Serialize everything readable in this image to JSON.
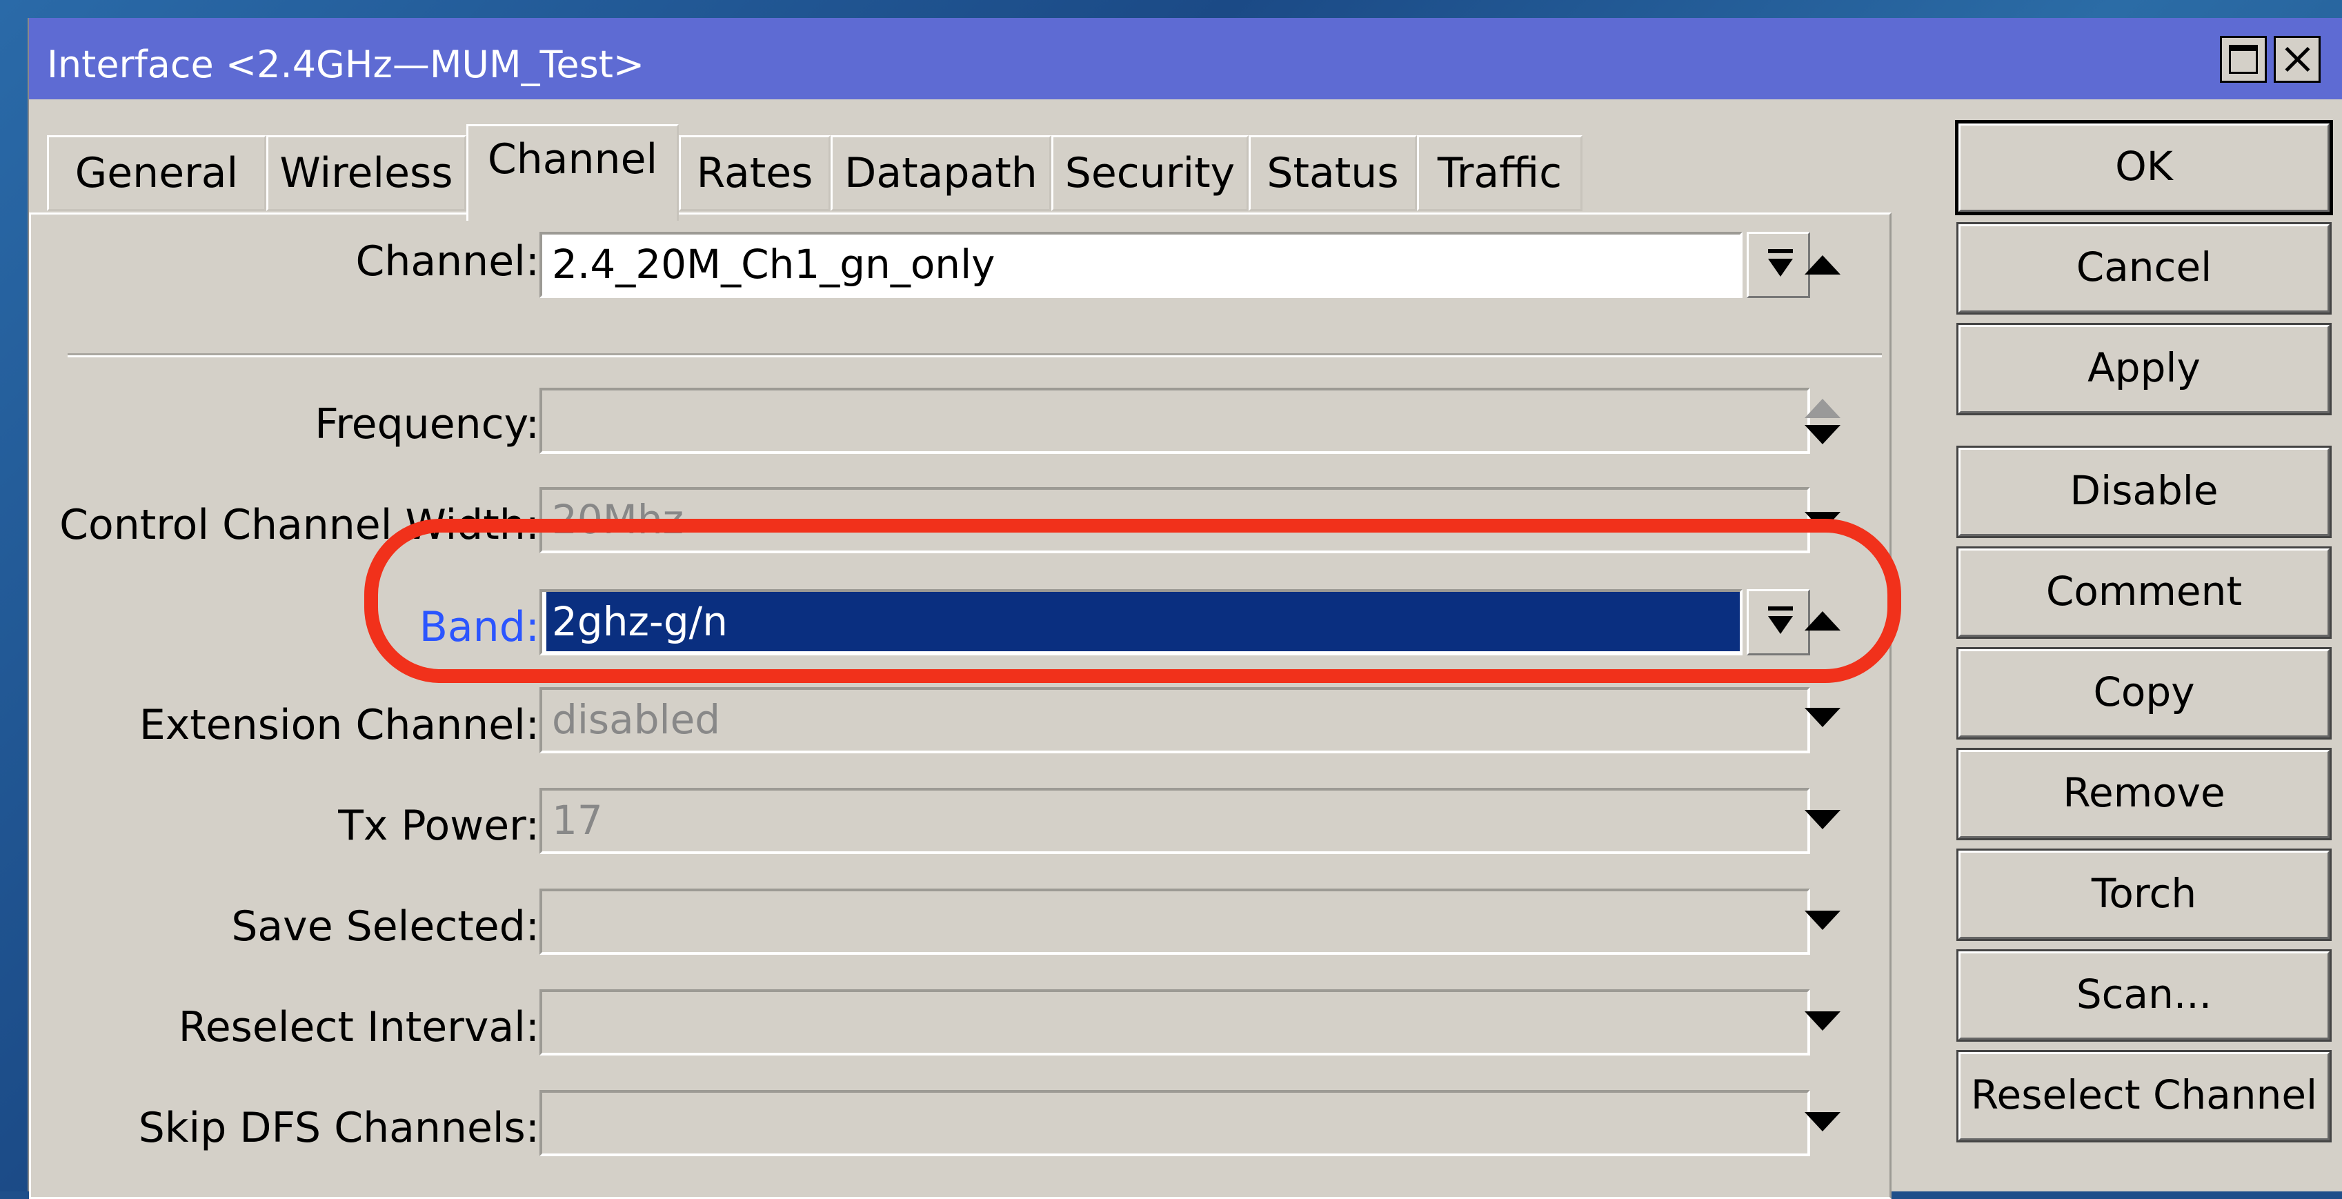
{
  "window": {
    "title": "Interface <2.4GHz—MUM_Test>"
  },
  "tabs": [
    {
      "label": "General"
    },
    {
      "label": "Wireless"
    },
    {
      "label": "Channel"
    },
    {
      "label": "Rates"
    },
    {
      "label": "Datapath"
    },
    {
      "label": "Security"
    },
    {
      "label": "Status"
    },
    {
      "label": "Traffic"
    }
  ],
  "active_tab": "Channel",
  "fields": {
    "channel": {
      "label": "Channel:",
      "value": "2.4_20M_Ch1_gn_only"
    },
    "frequency": {
      "label": "Frequency:",
      "value": ""
    },
    "control_channel_width": {
      "label": "Control Channel Width:",
      "value": "20Mhz"
    },
    "band": {
      "label": "Band:",
      "value": "2ghz-g/n"
    },
    "extension_channel": {
      "label": "Extension Channel:",
      "value": "disabled"
    },
    "tx_power": {
      "label": "Tx Power:",
      "value": "17"
    },
    "save_selected": {
      "label": "Save Selected:",
      "value": ""
    },
    "reselect_interval": {
      "label": "Reselect Interval:",
      "value": ""
    },
    "skip_dfs_channels": {
      "label": "Skip DFS Channels:",
      "value": ""
    }
  },
  "buttons": {
    "ok": "OK",
    "cancel": "Cancel",
    "apply": "Apply",
    "disable": "Disable",
    "comment": "Comment",
    "copy": "Copy",
    "remove": "Remove",
    "torch": "Torch",
    "scan": "Scan...",
    "reselect_channel": "Reselect Channel"
  },
  "colors": {
    "titlebar": "#5e6bd3",
    "selection": "#0a2f80",
    "highlight_label": "#2b55ff",
    "annotation": "#f1311b"
  }
}
